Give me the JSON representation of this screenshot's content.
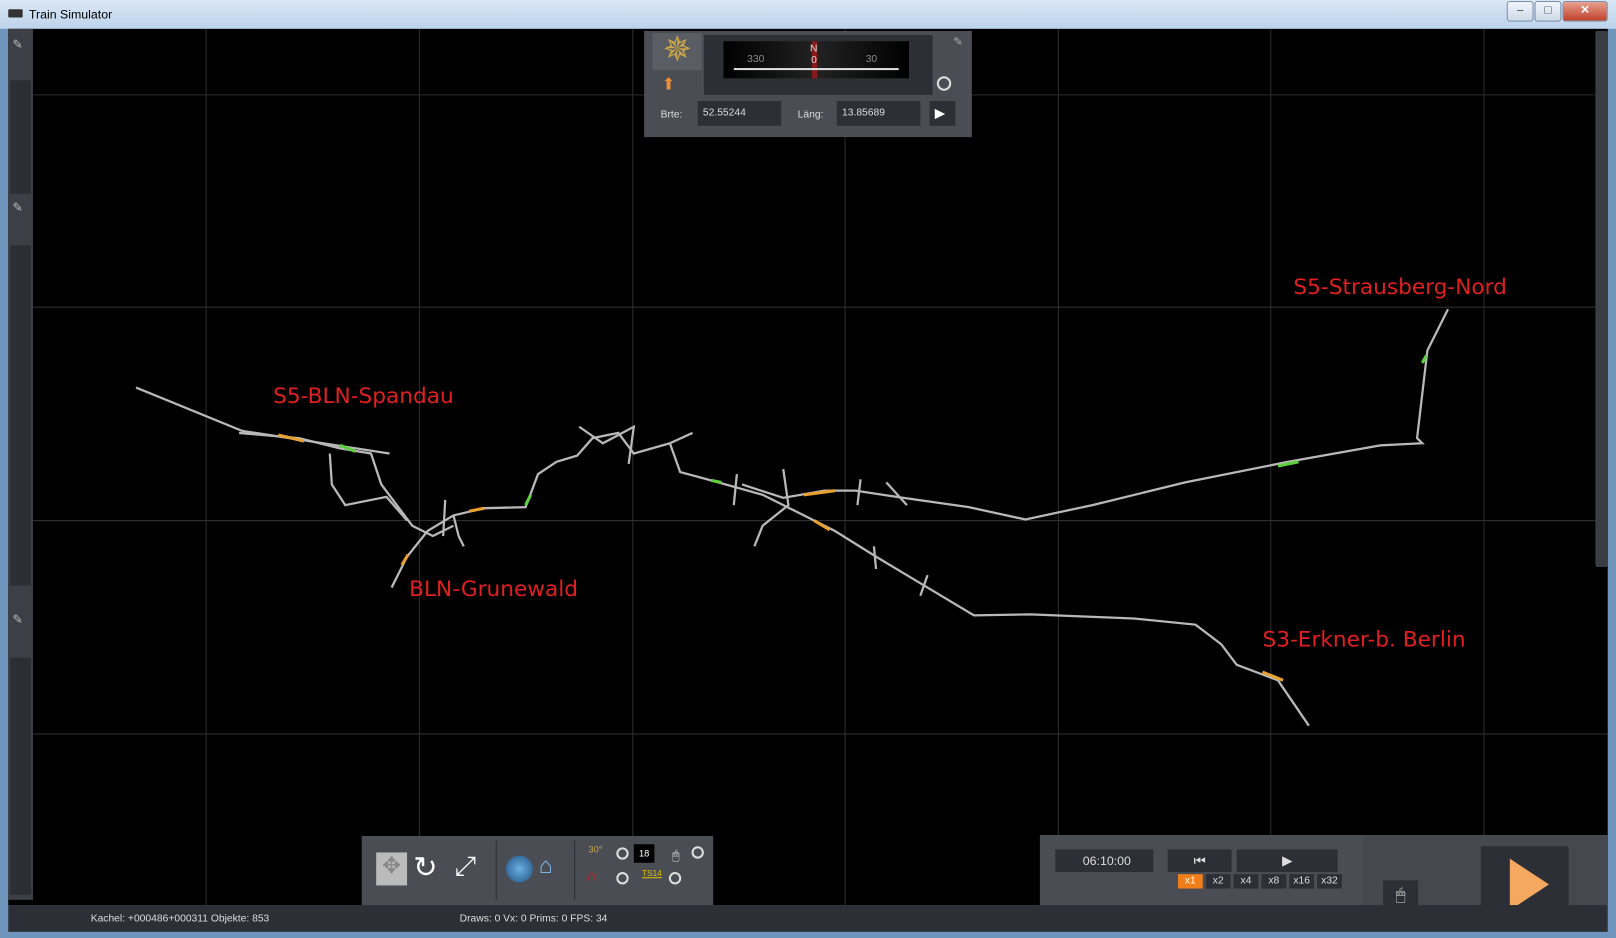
{
  "window": {
    "title": "Train Simulator",
    "min": "–",
    "max": "□",
    "close": "✕"
  },
  "compass": {
    "ticks": [
      "330",
      "N",
      "0",
      "30"
    ],
    "lat_label": "Brte:",
    "lat_value": "52.55244",
    "lon_label": "Läng:",
    "lon_value": "13.85689",
    "go": "▶"
  },
  "map_labels": [
    "S5-BLN-Spandau",
    "BLN-Grunewald",
    "S5-Strausberg-Nord",
    "S3-Erkner-b. Berlin"
  ],
  "toolbar": {
    "layer_count": "18",
    "ts_label": "TS14",
    "angle_label": "30°"
  },
  "time": {
    "clock": "06:10:00",
    "rewind": "⏮",
    "play": "▶",
    "speeds": [
      "x1",
      "x2",
      "x4",
      "x8",
      "x16",
      "x32"
    ],
    "active_speed": "x1"
  },
  "status": {
    "tile": "Kachel: +000486+000311  Objekte: 853",
    "stats": "Draws: 0 Vx: 0 Prims: 0 FPS: 34"
  },
  "colors": {
    "accent": "#f07e1a",
    "label": "#e02020",
    "track": "#b8b8b8"
  }
}
